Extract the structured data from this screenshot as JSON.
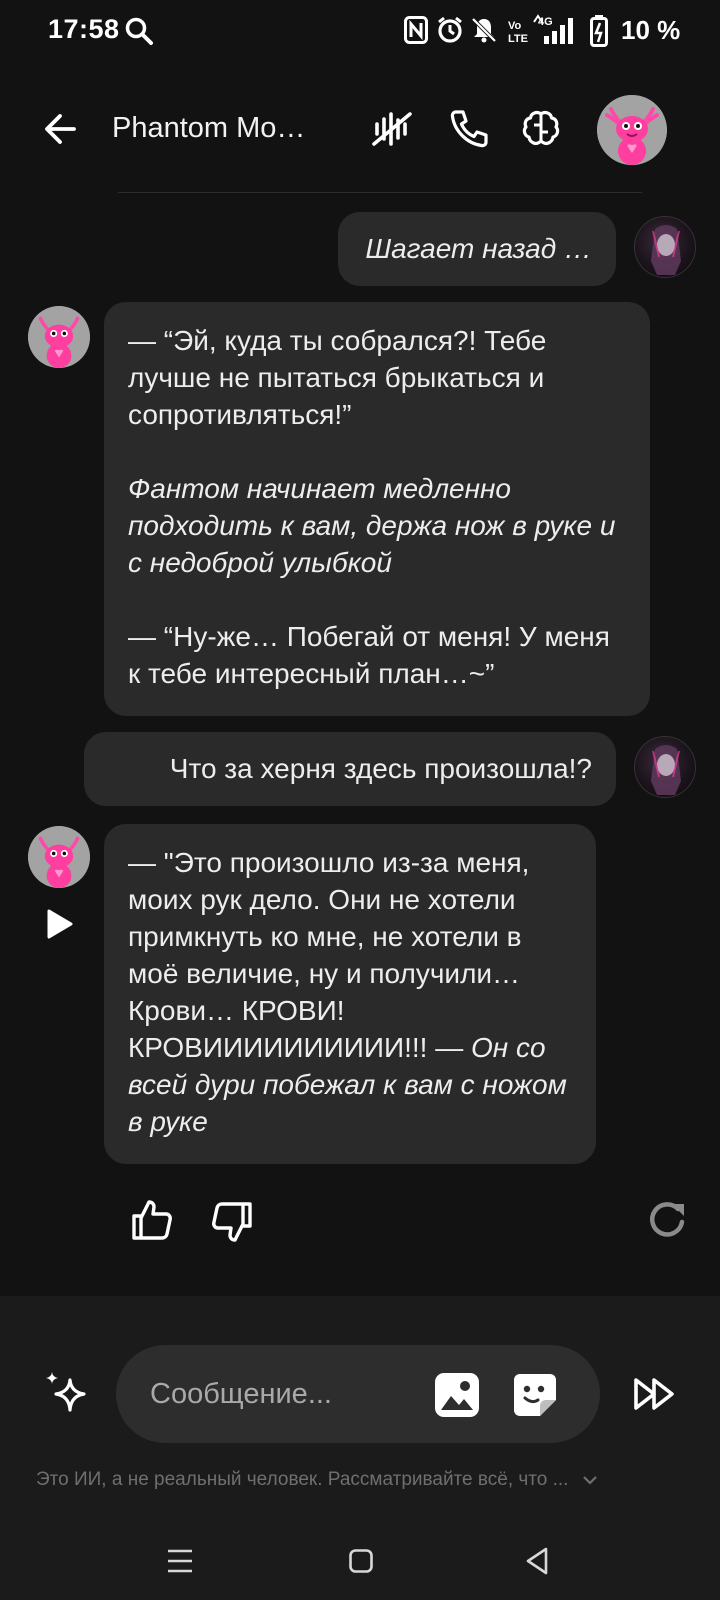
{
  "status_bar": {
    "time": "17:58",
    "battery_percent": "10 %",
    "icons": [
      "search-icon",
      "nfc-icon",
      "alarm-icon",
      "bell-off-icon",
      "volte-icon",
      "signal-4g-icon",
      "battery-icon"
    ]
  },
  "header": {
    "title": "Phantom Mo…",
    "icons": [
      "back-arrow-icon",
      "mute-voice-icon",
      "phone-icon",
      "brain-icon",
      "character-avatar"
    ]
  },
  "messages": [
    {
      "role": "user",
      "text": "Шагает назад …"
    },
    {
      "role": "bot",
      "paragraphs": [
        "— “Эй, куда ты собрался?! Тебе лучше не пытаться брыкаться и сопротивляться!”",
        "Фантом начинает медленно подходить к вам, держа нож в руке и с недоброй улыбкой",
        "— “Ну-же… Побегай от меня! У меня к тебе интересный план…~”"
      ]
    },
    {
      "role": "user",
      "text": "Что за херня здесь произошла!?"
    },
    {
      "role": "bot",
      "text_normal": "— \"Это произошло из-за меня, моих рук дело. Они не хотели примкнуть ко мне, не хотели в моё величие, ну и получили… Крови… КРОВИ! КРОВИИИИИИИИИИ!!! — ",
      "text_italic": "Он со всей дури побежал к вам с ножом в руке"
    }
  ],
  "reactions": [
    "thumbs-up-icon",
    "thumbs-down-icon",
    "regenerate-icon"
  ],
  "composer": {
    "placeholder": "Сообщение...",
    "icons": [
      "sparkle-icon",
      "image-icon",
      "sticker-icon",
      "fast-forward-icon"
    ]
  },
  "disclaimer": "Это ИИ, а не реальный человек. Рассматривайте всё, что ...",
  "colors": {
    "background": "#121212",
    "bubble": "#2a2a2a",
    "composer_bg": "#1b1b1b",
    "avatar_pink": "#ff3fa0"
  }
}
